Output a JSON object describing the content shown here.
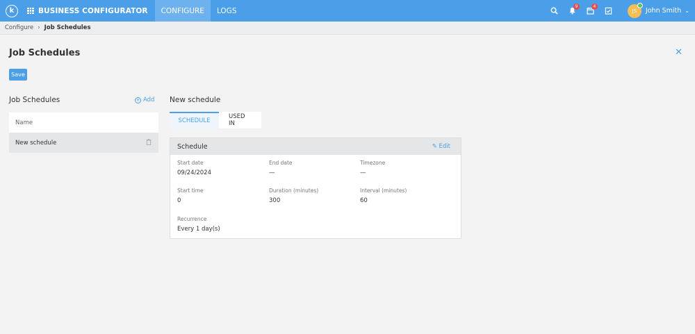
{
  "topbar": {
    "logo": "k",
    "brand": "BUSINESS CONFIGURATOR",
    "nav": [
      "CONFIGURE",
      "LOGS"
    ],
    "notifications_count": "9",
    "calendar_count": "4",
    "user_initials": "JS",
    "user_name": "John Smith",
    "icons": [
      "search-icon",
      "bell-icon",
      "calendar-icon",
      "checklist-icon",
      "chevron-down-icon"
    ]
  },
  "breadcrumb": {
    "parent": "Configure",
    "current": "Job Schedules"
  },
  "page": {
    "title": "Job Schedules",
    "save_label": "Save"
  },
  "left": {
    "title": "Job Schedules",
    "add_label": "Add",
    "column_header": "Name",
    "items": [
      {
        "name": "New schedule"
      }
    ]
  },
  "right": {
    "title": "New schedule",
    "tabs": [
      "SCHEDULE",
      "USED IN"
    ],
    "card_title": "Schedule",
    "edit_label": "Edit",
    "fields": {
      "start_date": {
        "label": "Start date",
        "value": "09/24/2024"
      },
      "end_date": {
        "label": "End date",
        "value": "—"
      },
      "timezone": {
        "label": "Timezone",
        "value": "—"
      },
      "start_time": {
        "label": "Start time",
        "value": "0"
      },
      "duration": {
        "label": "Duration (minutes)",
        "value": "300"
      },
      "interval": {
        "label": "Interval (minutes)",
        "value": "60"
      },
      "recurrence": {
        "label": "Recurrence",
        "value": "Every 1 day(s)"
      }
    }
  },
  "colors": {
    "primary": "#4a9fe8",
    "badge": "#e84c4c",
    "avatar": "#f4bf56"
  }
}
